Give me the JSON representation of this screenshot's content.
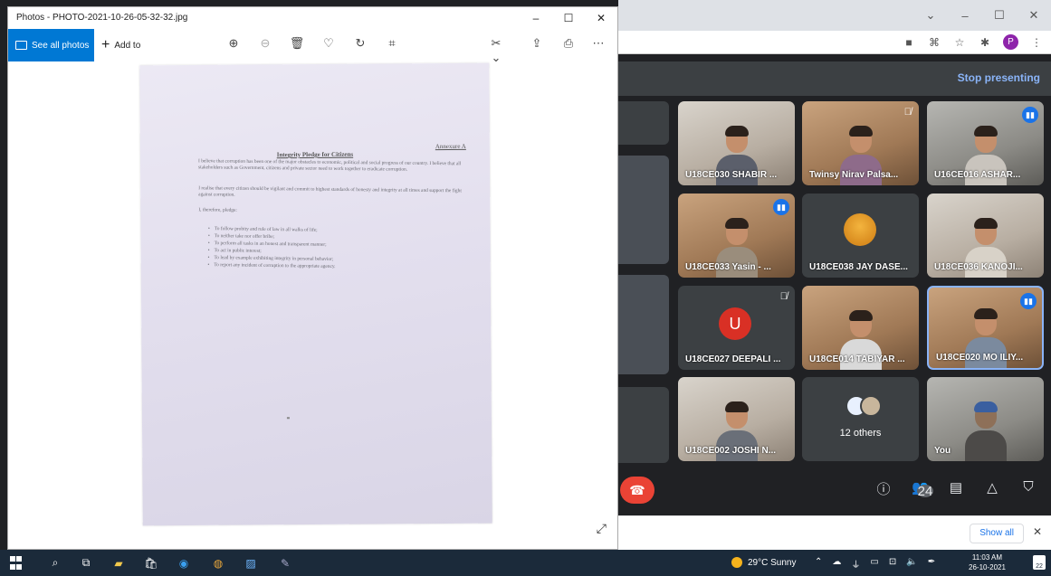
{
  "photos_app": {
    "title": "Photos - PHOTO-2021-10-26-05-32-32.jpg",
    "see_all_label": "See all photos",
    "add_to_label": "Add to",
    "controls": {
      "minimize": "–",
      "maximize": "☐",
      "close": "✕"
    },
    "toolbar_icons": [
      "zoom-in-icon",
      "zoom-out-icon",
      "delete-icon",
      "favorite-icon",
      "rotate-icon",
      "crop-icon",
      "edit-icon",
      "share-icon",
      "print-icon",
      "more-icon"
    ]
  },
  "document": {
    "annexure": "Annexure A",
    "title": "Integrity Pledge for Citizens",
    "para1": "I believe that corruption has been one of the major obstacles to economic, political and social progress of our country. I believe that all stakeholders such as Government, citizens and private sector need to work together to eradicate corruption.",
    "para2": "I realise that every citizen should be vigilant and commit to highest standards of honesty and integrity at all times and support the fight against corruption.",
    "para3": "I, therefore, pledge:",
    "bullets": [
      "To follow probity and rule of law in all walks of life;",
      "To neither take nor offer bribe;",
      "To perform all tasks in an honest and transparent manner;",
      "To act in public interest;",
      "To lead by example exhibiting integrity in personal behavior;",
      "To report any incident of corruption to the appropriate agency."
    ]
  },
  "meet": {
    "stop_presenting": "Stop presenting",
    "participants": [
      "U18CE030 SHABIR ...",
      "Twinsy Nirav Palsa...",
      "U16CE016 ASHAR...",
      "U18CE033 Yasin - ...",
      "U18CE038 JAY DASE...",
      "U18CE036 KANOJI...",
      "U18CE027 DEEPALI ...",
      "U18CE014 TABIYAR ...",
      "U18CE020 MO ILIY...",
      "U18CE002 JOSHI N...",
      "12 others",
      "You"
    ],
    "avatar_letter": "U",
    "people_count": "24",
    "accent_color": "#8ab4f8",
    "end_call_color": "#ea4335"
  },
  "chrome": {
    "profile_initial": "P",
    "show_all": "Show all"
  },
  "taskbar": {
    "weather": "29°C Sunny",
    "time": "11:03 AM",
    "date": "26-10-2021",
    "notifications": "22"
  }
}
